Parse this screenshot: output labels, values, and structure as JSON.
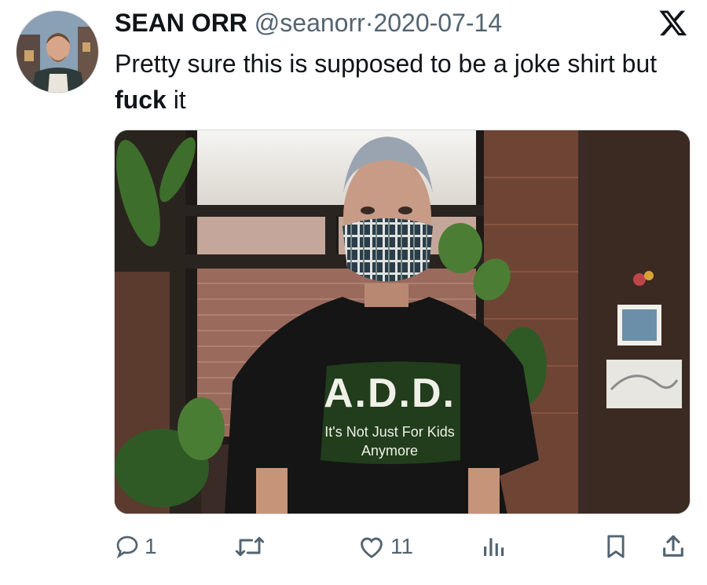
{
  "tweet": {
    "author_name": "SEAN ORR",
    "handle": "@seanorr",
    "separator": "·",
    "date": "2020-07-14",
    "text_before": "Pretty sure this is supposed to be a joke shirt but ",
    "text_bold": "fuck",
    "text_after": " it"
  },
  "media": {
    "shirt_line1": "A.D.D.",
    "shirt_line2": "It's Not Just For Kids",
    "shirt_line3": "Anymore"
  },
  "actions": {
    "reply_count": "1",
    "retweet_count": "",
    "like_count": "11"
  },
  "icons": {
    "brand": "x-logo-icon",
    "reply": "reply-icon",
    "retweet": "retweet-icon",
    "like": "heart-icon",
    "views": "views-icon",
    "bookmark": "bookmark-icon",
    "share": "share-icon"
  },
  "colors": {
    "text": "#0f1419",
    "muted": "#536471",
    "shirt_green": "#3d8a2e"
  }
}
